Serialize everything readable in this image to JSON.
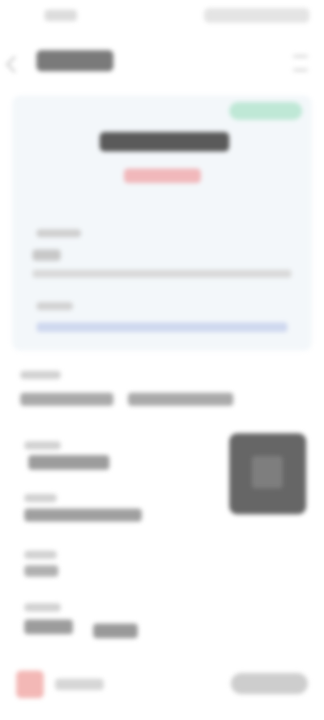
{
  "status_bar": {
    "time": "",
    "icons": ""
  },
  "nav": {
    "title": "",
    "back_icon": "back-chevron-icon",
    "menu_icon": "menu-icon"
  },
  "card": {
    "badge": "",
    "title": "",
    "subtitle": "",
    "description_label": "",
    "description": "",
    "link_label": "",
    "link": ""
  },
  "details": {
    "row1_label": "",
    "row1_value_a": "",
    "row1_value_b": "",
    "row2_label": "",
    "row2_value": "",
    "row3_label": "",
    "row3_value": "",
    "row4_label": "",
    "row4_value": "",
    "row5_label": "",
    "row5_value_a": "",
    "row5_value_b": ""
  },
  "qr": {
    "icon": "qr-code-icon"
  },
  "bottom_bar": {
    "icon": "app-icon",
    "label": "",
    "button": ""
  },
  "colors": {
    "card_bg": "#f3f7fa",
    "badge": "#bfe8d6",
    "subtitle": "#f1b8bb",
    "link": "#cfd8ef",
    "qr": "#666666"
  }
}
